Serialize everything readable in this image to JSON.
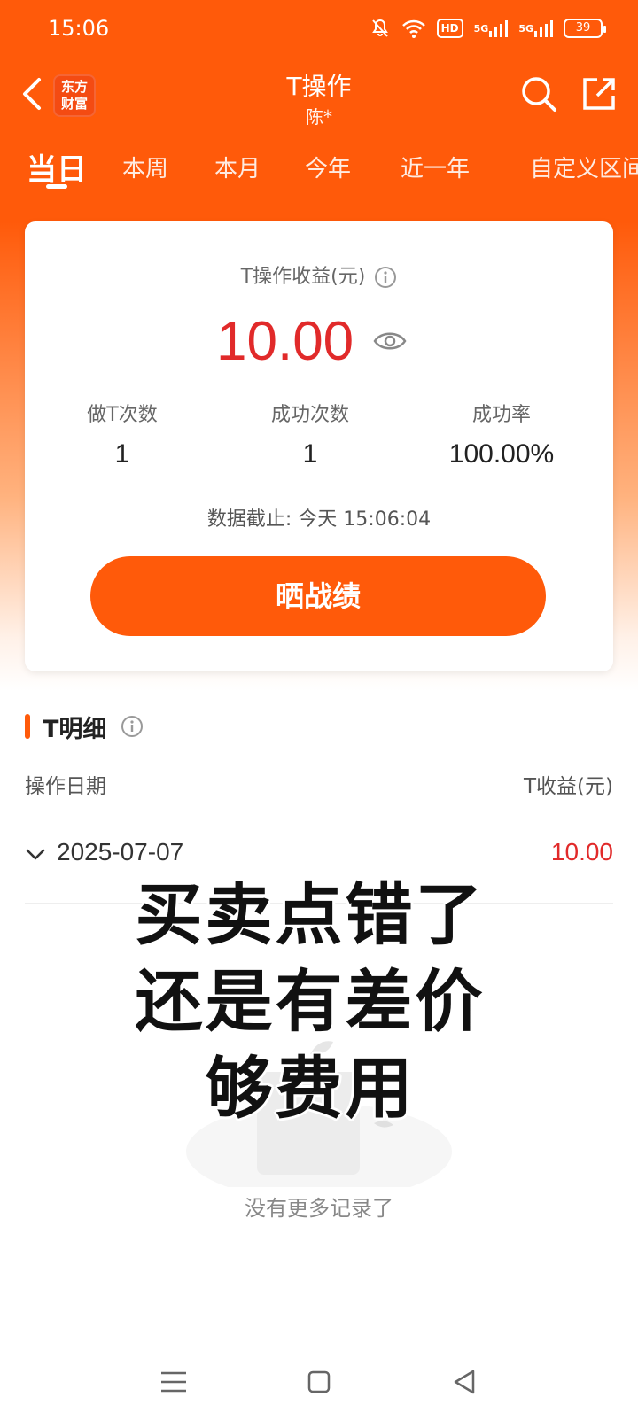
{
  "status_bar": {
    "time": "15:06",
    "hd_label": "HD",
    "sim1_label": "5G",
    "sim2_label": "5G",
    "battery": "39"
  },
  "header": {
    "logo_line1": "东方",
    "logo_line2": "财富",
    "title": "T操作",
    "subtitle": "陈*"
  },
  "tabs": [
    {
      "label": "当日",
      "active": true
    },
    {
      "label": "本周"
    },
    {
      "label": "本月"
    },
    {
      "label": "今年"
    },
    {
      "label": "近一年"
    },
    {
      "label": "自定义区间"
    }
  ],
  "summary": {
    "label": "T操作收益(元)",
    "profit": "10.00",
    "stats": [
      {
        "label": "做T次数",
        "value": "1"
      },
      {
        "label": "成功次数",
        "value": "1"
      },
      {
        "label": "成功率",
        "value": "100.00%"
      }
    ],
    "data_time": "数据截止: 今天 15:06:04",
    "share_button": "晒战绩"
  },
  "detail": {
    "title": "T明细",
    "col_date": "操作日期",
    "col_profit": "T收益(元)",
    "rows": [
      {
        "date": "2025-07-07",
        "profit": "10.00"
      }
    ],
    "empty_text": "没有更多记录了"
  },
  "overlay_caption": {
    "line1": "买卖点错了",
    "line2": "还是有差价",
    "line3": "够费用"
  },
  "colors": {
    "brand_orange": "#ff5a0a",
    "profit_red": "#e12a2a"
  }
}
